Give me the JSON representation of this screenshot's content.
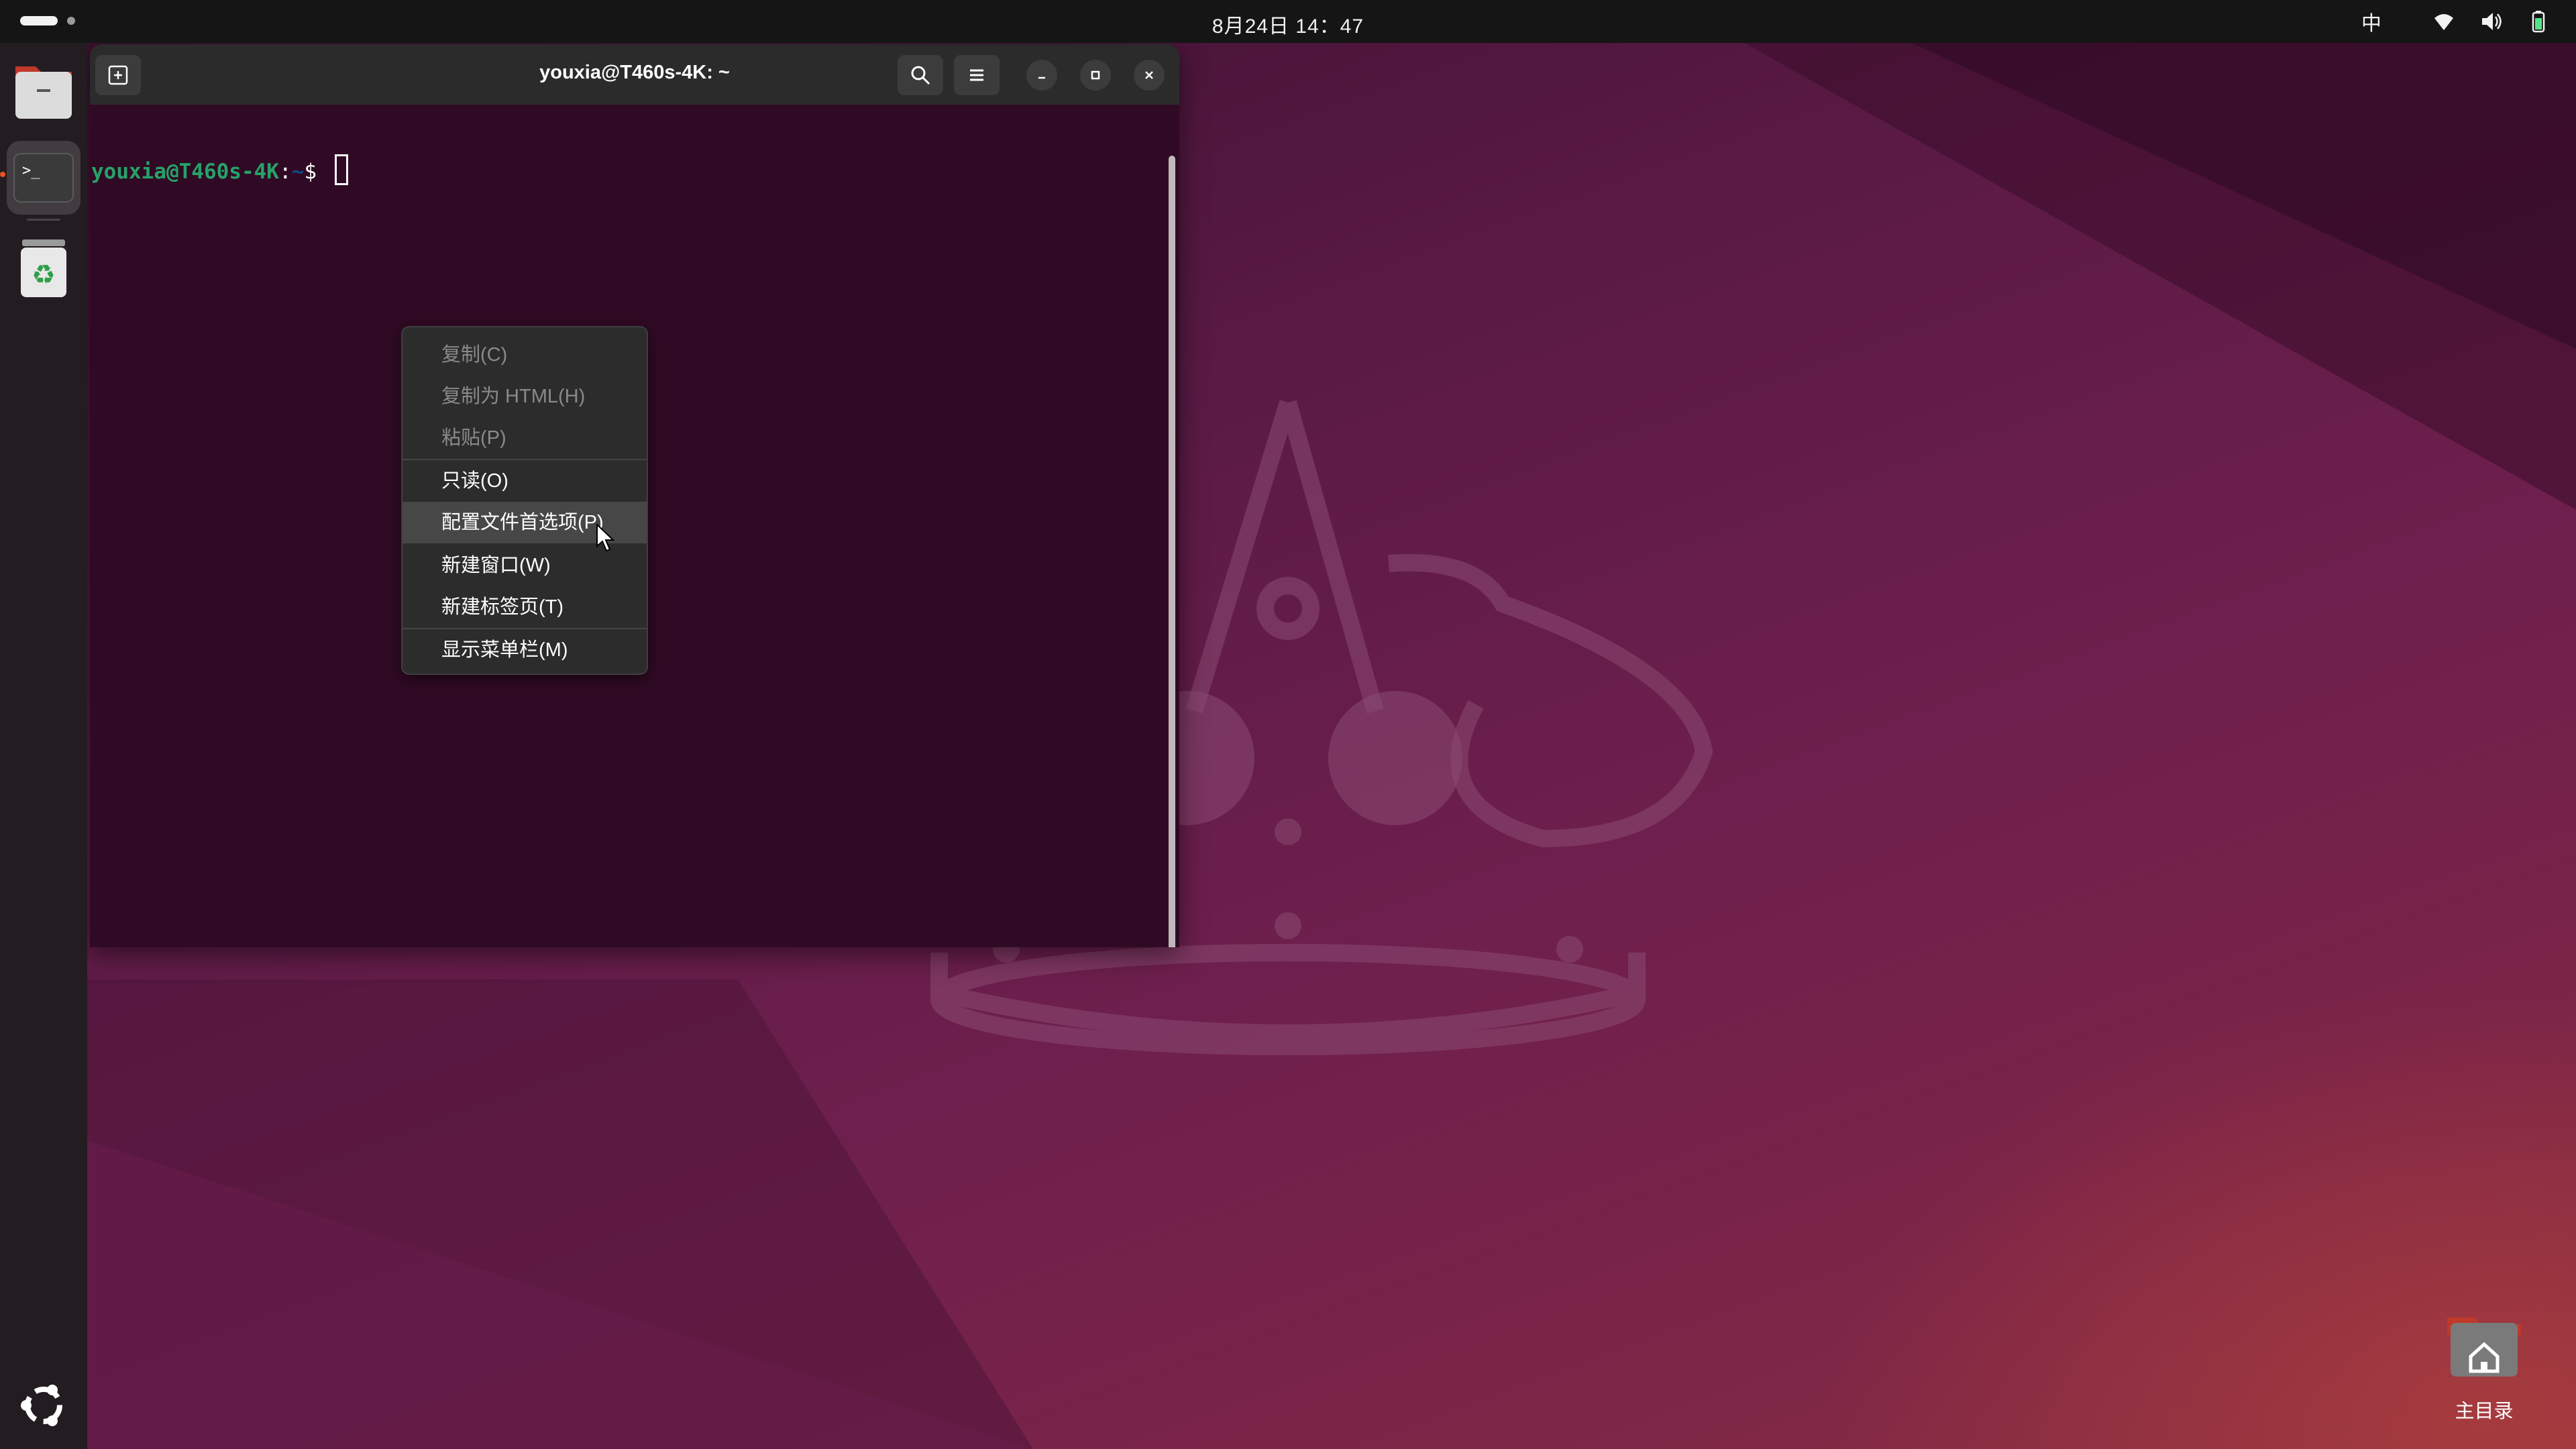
{
  "topbar": {
    "clock": "8月24日 14：47",
    "input_method": "中",
    "icons": [
      "wifi-icon",
      "volume-icon",
      "battery-icon"
    ]
  },
  "dock": {
    "items": [
      {
        "name": "files-app-icon"
      },
      {
        "name": "terminal-app-icon",
        "active": true
      },
      {
        "name": "trash-icon"
      }
    ],
    "show_apps": "ubuntu-logo-icon"
  },
  "terminal": {
    "title": "youxia@T460s-4K: ~",
    "prompt": {
      "user_host": "youxia@T460s-4K",
      "colon": ":",
      "path": "~",
      "dollar": "$ "
    },
    "colors": {
      "background": "#300a24",
      "user": "#26a269",
      "path": "#12488b"
    }
  },
  "context_menu": {
    "items": [
      {
        "label": "复制(C)",
        "enabled": false
      },
      {
        "label": "复制为 HTML(H)",
        "enabled": false
      },
      {
        "label": "粘贴(P)",
        "enabled": false
      },
      {
        "label": "只读(O)",
        "enabled": true
      },
      {
        "label": "配置文件首选项(P)",
        "enabled": true,
        "hovered": true
      },
      {
        "label": "新建窗口(W)",
        "enabled": true
      },
      {
        "label": "新建标签页(T)",
        "enabled": true
      },
      {
        "label": "显示菜单栏(M)",
        "enabled": true
      }
    ]
  },
  "desktop": {
    "home_label": "主目录",
    "accent": "#e95420"
  }
}
